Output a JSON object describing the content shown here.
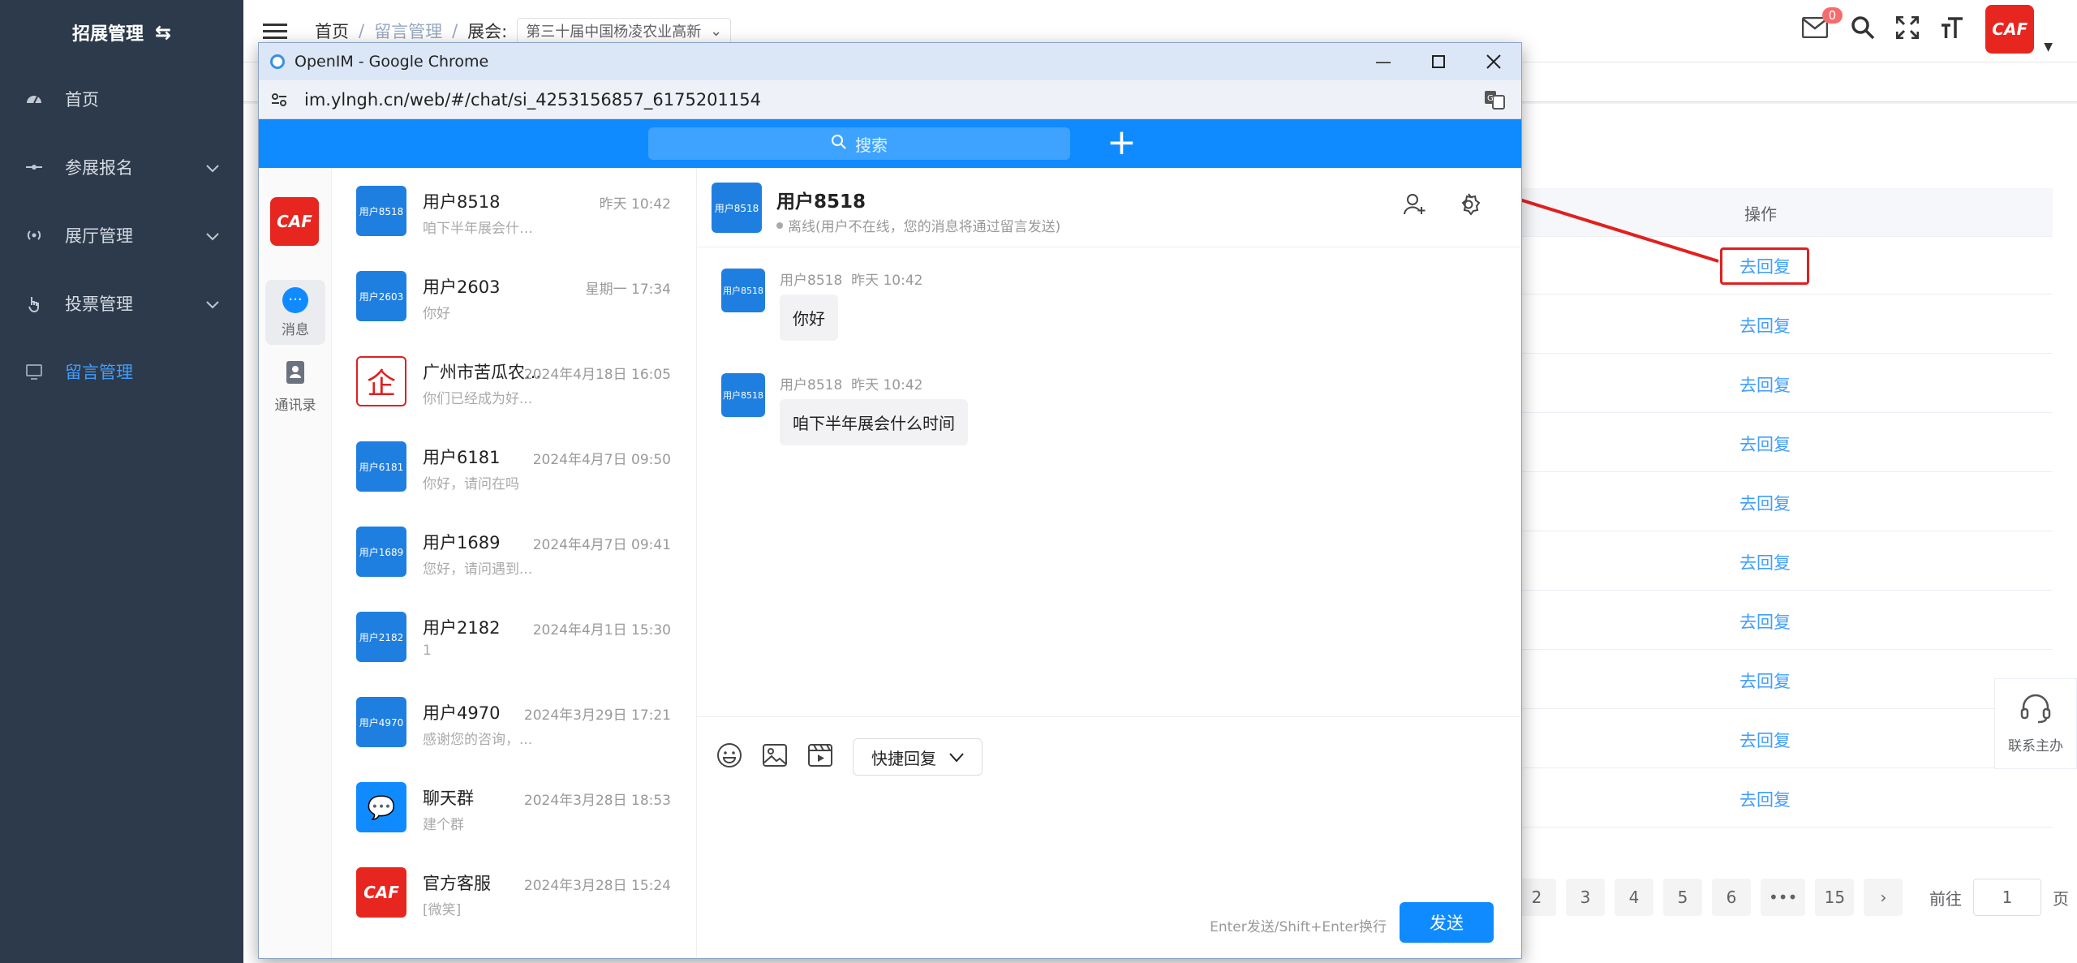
{
  "admin": {
    "brand": "招展管理",
    "menu": [
      {
        "label": "首页"
      },
      {
        "label": "参展报名"
      },
      {
        "label": "展厅管理"
      },
      {
        "label": "投票管理"
      },
      {
        "label": "留言管理"
      }
    ],
    "breadcrumb": {
      "home": "首页",
      "section": "留言管理",
      "exhibit_label": "展会:",
      "exhibit_value": "第三十届中国杨凌农业高新"
    },
    "mail_badge": "0",
    "avatar_text": "CAF",
    "table_header_action": "操作",
    "reply_label": "去回复",
    "pager": [
      "2",
      "3",
      "4",
      "5",
      "6",
      "•••",
      "15",
      "›"
    ],
    "goto_label": "前往",
    "goto_value": "1",
    "goto_unit": "页",
    "contact_host": "联系主办"
  },
  "chrome": {
    "title": "OpenIM - Google Chrome",
    "url": "im.ylngh.cn/web/#/chat/si_4253156857_6175201154"
  },
  "im": {
    "search_placeholder": "搜索",
    "nav": {
      "messages": "消息",
      "contacts": "通讯录",
      "logo": "CAF"
    },
    "conversations": [
      {
        "avatar": "用户8518",
        "name": "用户8518",
        "time": "昨天 10:42",
        "msg": "咱下半年展会什…"
      },
      {
        "avatar": "用户2603",
        "name": "用户2603",
        "time": "星期一 17:34",
        "msg": "你好"
      },
      {
        "avatar": "企",
        "name": "广州市苦瓜农...",
        "time": "2024年4月18日 16:05",
        "msg": "你们已经成为好..."
      },
      {
        "avatar": "用户6181",
        "name": "用户6181",
        "time": "2024年4月7日 09:50",
        "msg": "你好，请问在吗"
      },
      {
        "avatar": "用户1689",
        "name": "用户1689",
        "time": "2024年4月7日 09:41",
        "msg": "您好，请问遇到..."
      },
      {
        "avatar": "用户2182",
        "name": "用户2182",
        "time": "2024年4月1日 15:30",
        "msg": "1"
      },
      {
        "avatar": "用户4970",
        "name": "用户4970",
        "time": "2024年3月29日 17:21",
        "msg": "感谢您的咨询，..."
      },
      {
        "avatar": "💬",
        "name": "聊天群",
        "time": "2024年3月28日 18:53",
        "msg": "建个群"
      },
      {
        "avatar": "CAF",
        "name": "官方客服",
        "time": "2024年3月28日 15:24",
        "msg": "[微笑]"
      }
    ],
    "chat": {
      "avatar": "用户8518",
      "title": "用户8518",
      "status": "离线(用户不在线，您的消息将通过留言发送)",
      "messages": [
        {
          "sender": "用户8518",
          "time": "昨天 10:42",
          "text": "你好"
        },
        {
          "sender": "用户8518",
          "time": "昨天 10:42",
          "text": "咱下半年展会什么时间"
        }
      ],
      "quick_reply": "快捷回复",
      "hint": "Enter发送/Shift+Enter换行",
      "send": "发送"
    }
  }
}
